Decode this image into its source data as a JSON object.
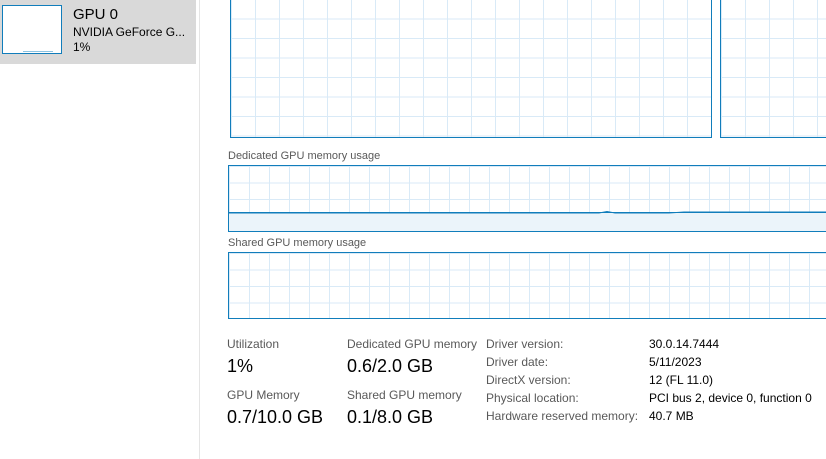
{
  "sidebar": {
    "items": [
      {
        "name": "GPU 0",
        "model": "NVIDIA GeForce G...",
        "utilization": "1%"
      }
    ]
  },
  "graphs": {
    "dedicated_label": "Dedicated GPU memory usage",
    "shared_label": "Shared GPU memory usage"
  },
  "stats": {
    "utilization": {
      "label": "Utilization",
      "value": "1%"
    },
    "dedicated_memory": {
      "label": "Dedicated GPU memory",
      "value": "0.6/2.0 GB"
    },
    "gpu_memory": {
      "label": "GPU Memory",
      "value": "0.7/10.0 GB"
    },
    "shared_memory": {
      "label": "Shared GPU memory",
      "value": "0.1/8.0 GB"
    }
  },
  "info": [
    {
      "label": "Driver version:",
      "value": "30.0.14.7444"
    },
    {
      "label": "Driver date:",
      "value": "5/11/2023"
    },
    {
      "label": "DirectX version:",
      "value": "12 (FL 11.0)"
    },
    {
      "label": "Physical location:",
      "value": "PCI bus 2, device 0, function 0"
    },
    {
      "label": "Hardware reserved memory:",
      "value": "40.7 MB"
    }
  ],
  "colors": {
    "graph_border": "#117dbb",
    "grid_line": "#d9eaf7",
    "selected_bg": "#d9d9d9"
  }
}
